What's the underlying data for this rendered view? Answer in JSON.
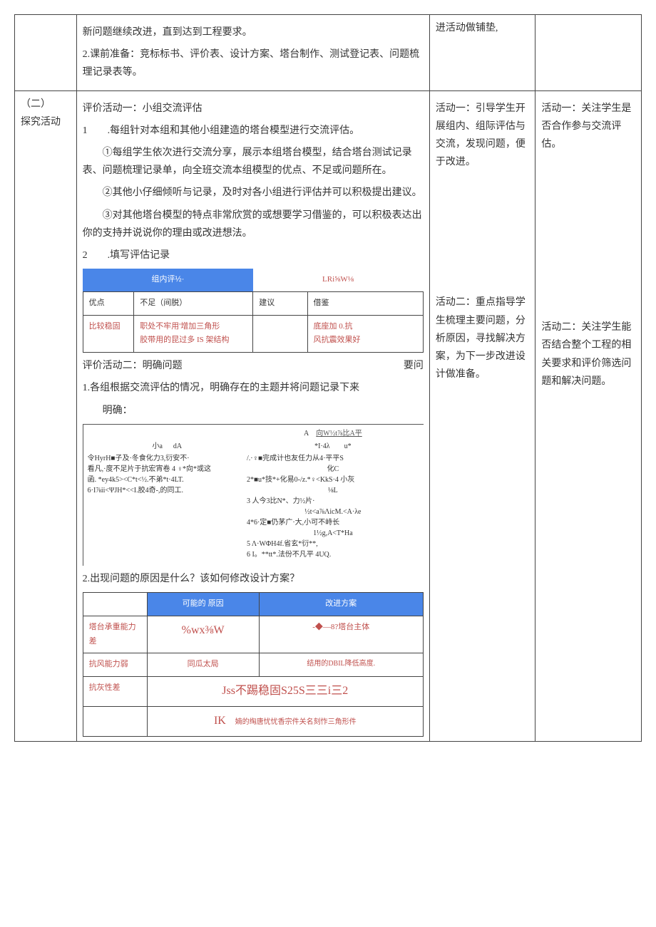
{
  "row1": {
    "main_p1": "新问题继续改进，直到达到工程要求。",
    "main_p2": "2.课前准备：竞标标书、评价表、设计方案、塔台制作、测试登记表、问题梳理记录表等。",
    "t1": "进活动做铺垫,"
  },
  "row2": {
    "left_l1": "（二）",
    "left_l2": "探究活动",
    "act1_title": "评价活动一：小组交流评估",
    "act1_item1": "1　　.每组针对本组和其他小组建造的塔台模型进行交流评估。",
    "act1_sub1": "①每组学生依次进行交流分享，展示本组塔台模型，结合塔台测试记录表、问题梳理记录单，向全班交流本组模型的优点、不足或问题所在。",
    "act1_sub2": "②其他小仔细倾听与记录，及时对各小组进行评估并可以积极提出建议。",
    "act1_sub3": "③对其他塔台模型的特点非常欣赏的或想要学习借鉴的，可以积极表达出你的支持并说说你的理由或改进想法。",
    "act1_item2": "2　　.填写评估记录",
    "eval_hdr_left": "组内评½·",
    "eval_hdr_right": "LRi⅝W⅛",
    "eval_c1": "优点",
    "eval_c2": "不足（间脱）",
    "eval_c3": "建议",
    "eval_c4": "借鉴",
    "eval_v1": "比较稳固",
    "eval_v2a": "职处不牢用'增加三角形",
    "eval_v2b": "胶带用的昆过多 IS 架结构",
    "eval_v4a": "底座加 0.抗",
    "eval_v4b": "风抗震效果好",
    "act2_title": "评价活动二：明确问题",
    "act2_req": "要问",
    "act2_item1": "1.各组根据交流评估的情况，明确存在的主题并将问题记录下来",
    "act2_label": "明确：",
    "rec_hdr_a": "A",
    "rec_hdr_link": "向W½t⅞比A平",
    "rec_row_l": "小a",
    "rec_row_m": "dA",
    "rec_row_r": "*I·4λ　　u*",
    "rec_left_l1": "令HyrH■子及·冬食化力3,衍安不·",
    "rec_left_l2": "看凡,·度不足片于抗宏宵卷 4 ♀*向*或这",
    "rec_left_l3": "函. *ey4k5><C*t<½.不弟*t·4LT.",
    "rec_left_l4": "6·I⅞ii<ΨJH*<<I.胶4奇-,的同工.",
    "rec_r1": "/.·♀■完成计也友任力从4·平平S",
    "rec_r2": "化C",
    "rec_r3": "2*■u*技*+化易0-/z.*♀<KkS·4 小灰",
    "rec_r4": "⅛L",
    "rec_r5": "3 人今3比N*、力½片·",
    "rec_r6": "½t<a⅞ΛicM.<A·λe",
    "rec_r7": "4*6·定■仍茅广·大,小可不峙长",
    "rec_r8": "1½g,A<T*Ha",
    "rec_r9": "5 Λ·WΦH4f.省玄*衍**,",
    "rec_r10": "6 I。**tt*.法份不凡平 4UQ.",
    "act2_item2": "2.出现问题的原因是什么？该如何修改设计方案？",
    "plan_h2": "可能的 原因",
    "plan_h3": "改进方案",
    "plan_r1_label": "塔台承重能力差",
    "plan_r1_m": "%wx⅜W",
    "plan_r1_r": "-◆—8?塔台主体",
    "plan_r2_label": "抗风能力弱",
    "plan_r2_m": "同瓜太局",
    "plan_r2_r": "结用的DBIL降低高度.",
    "plan_r3_label": "抗灰性差",
    "plan_r3_mix": "Jss不踢稳固S25S三三i三2",
    "plan_r4_mix": "IK",
    "plan_r4_txt": "　婻的绹唐忧忧香宗件关名刻怍三角形件",
    "t1_act1": "活动一：引导学生开展组内、组际评估与交流，发现问题，便于改进。",
    "t2_act1": "活动一：关注学生是否合作参与交流评估。",
    "t1_act2": "活动二：重点指导学生梳理主要问题，分析原因，寻找解决方案，为下一步改进设计做准备。",
    "t2_act2": "活动二：关注学生能否结合整个工程的相关要求和评价筛选问题和解决问题。"
  }
}
